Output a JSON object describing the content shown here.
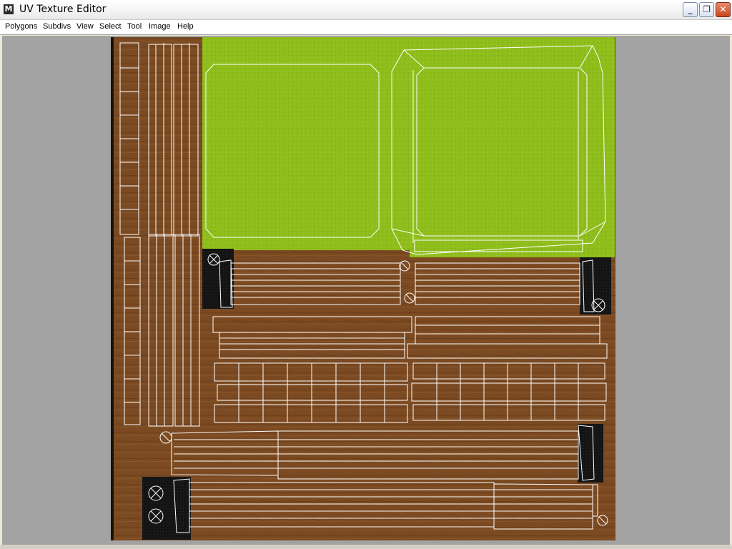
{
  "window": {
    "title": "UV Texture Editor",
    "app_icon": "M",
    "controls": {
      "minimize": "_",
      "maximize": "❐",
      "close": "✕"
    }
  },
  "menu": {
    "items": [
      "Polygons",
      "Subdivs",
      "View",
      "Select",
      "Tool",
      "Image",
      "Help"
    ]
  },
  "colors": {
    "viewport_bg": "#a3a3a3",
    "grass": "#8fbd1c",
    "wood": "#7b4a22",
    "uv_line": "#ffffff",
    "dark_corner": "#141414"
  }
}
